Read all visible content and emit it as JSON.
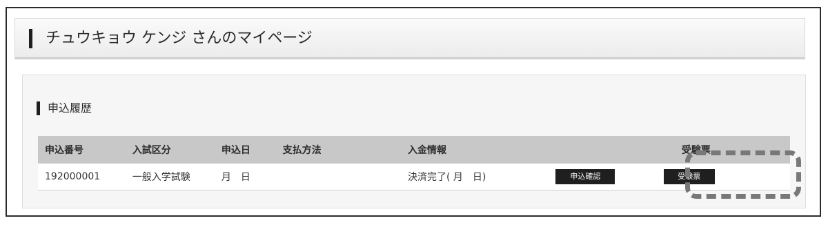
{
  "header": {
    "title": "チュウキョウ ケンジ さんのマイページ"
  },
  "section": {
    "title": "申込履歴"
  },
  "table": {
    "columns": [
      "申込番号",
      "入試区分",
      "申込日",
      "支払方法",
      "入金情報",
      "",
      "受験票"
    ],
    "rows": [
      {
        "application_number": "192000001",
        "exam_type": "一般入学試験",
        "application_date": "月　日",
        "payment_method": "",
        "payment_info": "決済完了( 月　日)",
        "confirm_button": "申込確認",
        "ticket_button": "受験票"
      }
    ]
  },
  "colors": {
    "button_bg": "#1f1f1f",
    "table_header_bg": "#c8c8c8",
    "highlight_border": "#787878"
  }
}
